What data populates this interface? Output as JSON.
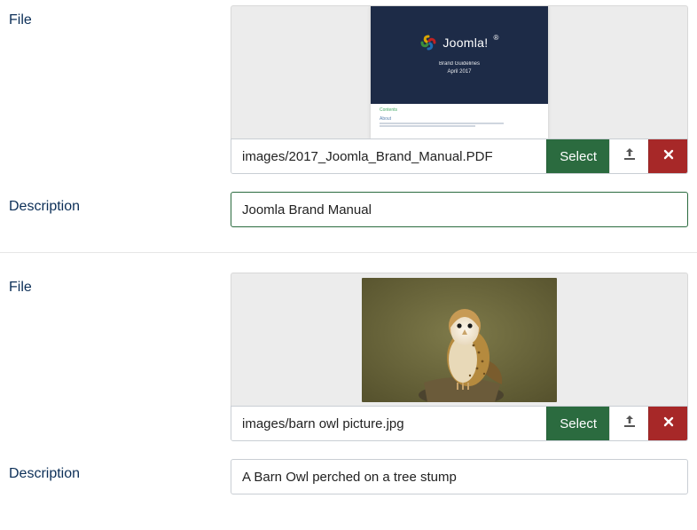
{
  "labels": {
    "file": "File",
    "description": "Description"
  },
  "buttons": {
    "select": "Select"
  },
  "items": [
    {
      "path": "images/2017_Joomla_Brand_Manual.PDF",
      "description": "Joomla Brand Manual",
      "preview_type": "pdf",
      "pdf": {
        "brand": "Joomla!",
        "subtitle1": "Brand Guidelines",
        "subtitle2": "April 2017",
        "toc_title": "Contents"
      }
    },
    {
      "path": "images/barn owl picture.jpg",
      "description": "A Barn Owl perched on a tree stump",
      "preview_type": "image-owl"
    }
  ],
  "icons": {
    "upload": "upload-icon",
    "remove": "close-icon"
  }
}
